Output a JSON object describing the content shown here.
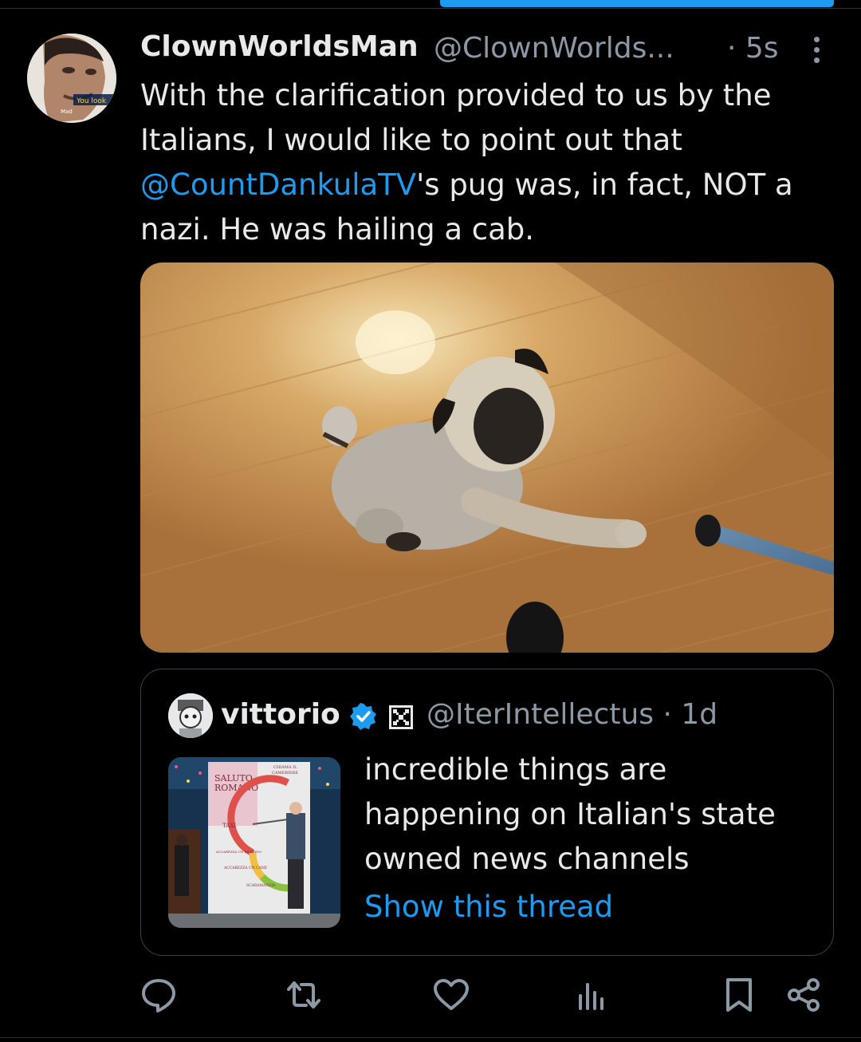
{
  "tweet": {
    "author_name": "ClownWorldsMan",
    "author_handle": "@ClownWorlds...",
    "time": "· 5s",
    "text_lines": [
      "With the clarification provided to us by the",
      "Italians, I would like to point out that"
    ],
    "mention": "@CountDankulaTV",
    "text_after_mention": "'s pug was, in fact, NOT a",
    "text_last_line": "nazi. He was hailing a cab.",
    "avatar_caption": "You look",
    "avatar_caption2": "Mad"
  },
  "quote": {
    "author_name": "vittorio",
    "author_handle": "@IterIntellectus · 1d",
    "text_lines": [
      "incredible things are",
      "happening on Italian's state",
      "owned news channels"
    ],
    "show_thread": "Show this thread",
    "thumb_labels": {
      "saluto": "SALUTO",
      "romano": "ROMANO",
      "taxi": "TAXI",
      "chiama": "CHIAMA IL",
      "cameriere": "CAMERIERE",
      "carezza_bambino": "ACCAREZZA UN BAMBINO",
      "carezza_cane": "ACCAREZZA UN CANE",
      "scaramanzia": "SCARAMANZIA"
    }
  },
  "icons": {
    "reply": "reply-icon",
    "retweet": "retweet-icon",
    "like": "like-icon",
    "views": "views-icon",
    "bookmark": "bookmark-icon",
    "share": "share-icon",
    "more": "more-vertical-icon",
    "verified": "verified-badge-icon"
  },
  "colors": {
    "accent": "#1d9bf0",
    "muted": "#8b98a5",
    "text": "#e7e9ea",
    "background": "#000000"
  }
}
